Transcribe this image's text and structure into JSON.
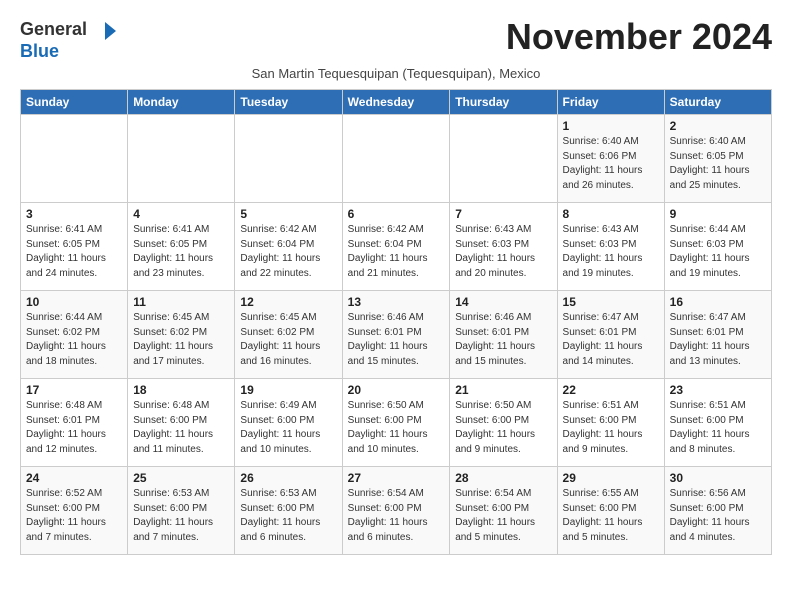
{
  "header": {
    "logo_general": "General",
    "logo_blue": "Blue",
    "month_title": "November 2024",
    "subtitle": "San Martin Tequesquipan (Tequesquipan), Mexico"
  },
  "weekdays": [
    "Sunday",
    "Monday",
    "Tuesday",
    "Wednesday",
    "Thursday",
    "Friday",
    "Saturday"
  ],
  "weeks": [
    [
      {
        "day": "",
        "info": ""
      },
      {
        "day": "",
        "info": ""
      },
      {
        "day": "",
        "info": ""
      },
      {
        "day": "",
        "info": ""
      },
      {
        "day": "",
        "info": ""
      },
      {
        "day": "1",
        "info": "Sunrise: 6:40 AM\nSunset: 6:06 PM\nDaylight: 11 hours\nand 26 minutes."
      },
      {
        "day": "2",
        "info": "Sunrise: 6:40 AM\nSunset: 6:05 PM\nDaylight: 11 hours\nand 25 minutes."
      }
    ],
    [
      {
        "day": "3",
        "info": "Sunrise: 6:41 AM\nSunset: 6:05 PM\nDaylight: 11 hours\nand 24 minutes."
      },
      {
        "day": "4",
        "info": "Sunrise: 6:41 AM\nSunset: 6:05 PM\nDaylight: 11 hours\nand 23 minutes."
      },
      {
        "day": "5",
        "info": "Sunrise: 6:42 AM\nSunset: 6:04 PM\nDaylight: 11 hours\nand 22 minutes."
      },
      {
        "day": "6",
        "info": "Sunrise: 6:42 AM\nSunset: 6:04 PM\nDaylight: 11 hours\nand 21 minutes."
      },
      {
        "day": "7",
        "info": "Sunrise: 6:43 AM\nSunset: 6:03 PM\nDaylight: 11 hours\nand 20 minutes."
      },
      {
        "day": "8",
        "info": "Sunrise: 6:43 AM\nSunset: 6:03 PM\nDaylight: 11 hours\nand 19 minutes."
      },
      {
        "day": "9",
        "info": "Sunrise: 6:44 AM\nSunset: 6:03 PM\nDaylight: 11 hours\nand 19 minutes."
      }
    ],
    [
      {
        "day": "10",
        "info": "Sunrise: 6:44 AM\nSunset: 6:02 PM\nDaylight: 11 hours\nand 18 minutes."
      },
      {
        "day": "11",
        "info": "Sunrise: 6:45 AM\nSunset: 6:02 PM\nDaylight: 11 hours\nand 17 minutes."
      },
      {
        "day": "12",
        "info": "Sunrise: 6:45 AM\nSunset: 6:02 PM\nDaylight: 11 hours\nand 16 minutes."
      },
      {
        "day": "13",
        "info": "Sunrise: 6:46 AM\nSunset: 6:01 PM\nDaylight: 11 hours\nand 15 minutes."
      },
      {
        "day": "14",
        "info": "Sunrise: 6:46 AM\nSunset: 6:01 PM\nDaylight: 11 hours\nand 15 minutes."
      },
      {
        "day": "15",
        "info": "Sunrise: 6:47 AM\nSunset: 6:01 PM\nDaylight: 11 hours\nand 14 minutes."
      },
      {
        "day": "16",
        "info": "Sunrise: 6:47 AM\nSunset: 6:01 PM\nDaylight: 11 hours\nand 13 minutes."
      }
    ],
    [
      {
        "day": "17",
        "info": "Sunrise: 6:48 AM\nSunset: 6:01 PM\nDaylight: 11 hours\nand 12 minutes."
      },
      {
        "day": "18",
        "info": "Sunrise: 6:48 AM\nSunset: 6:00 PM\nDaylight: 11 hours\nand 11 minutes."
      },
      {
        "day": "19",
        "info": "Sunrise: 6:49 AM\nSunset: 6:00 PM\nDaylight: 11 hours\nand 10 minutes."
      },
      {
        "day": "20",
        "info": "Sunrise: 6:50 AM\nSunset: 6:00 PM\nDaylight: 11 hours\nand 10 minutes."
      },
      {
        "day": "21",
        "info": "Sunrise: 6:50 AM\nSunset: 6:00 PM\nDaylight: 11 hours\nand 9 minutes."
      },
      {
        "day": "22",
        "info": "Sunrise: 6:51 AM\nSunset: 6:00 PM\nDaylight: 11 hours\nand 9 minutes."
      },
      {
        "day": "23",
        "info": "Sunrise: 6:51 AM\nSunset: 6:00 PM\nDaylight: 11 hours\nand 8 minutes."
      }
    ],
    [
      {
        "day": "24",
        "info": "Sunrise: 6:52 AM\nSunset: 6:00 PM\nDaylight: 11 hours\nand 7 minutes."
      },
      {
        "day": "25",
        "info": "Sunrise: 6:53 AM\nSunset: 6:00 PM\nDaylight: 11 hours\nand 7 minutes."
      },
      {
        "day": "26",
        "info": "Sunrise: 6:53 AM\nSunset: 6:00 PM\nDaylight: 11 hours\nand 6 minutes."
      },
      {
        "day": "27",
        "info": "Sunrise: 6:54 AM\nSunset: 6:00 PM\nDaylight: 11 hours\nand 6 minutes."
      },
      {
        "day": "28",
        "info": "Sunrise: 6:54 AM\nSunset: 6:00 PM\nDaylight: 11 hours\nand 5 minutes."
      },
      {
        "day": "29",
        "info": "Sunrise: 6:55 AM\nSunset: 6:00 PM\nDaylight: 11 hours\nand 5 minutes."
      },
      {
        "day": "30",
        "info": "Sunrise: 6:56 AM\nSunset: 6:00 PM\nDaylight: 11 hours\nand 4 minutes."
      }
    ]
  ]
}
